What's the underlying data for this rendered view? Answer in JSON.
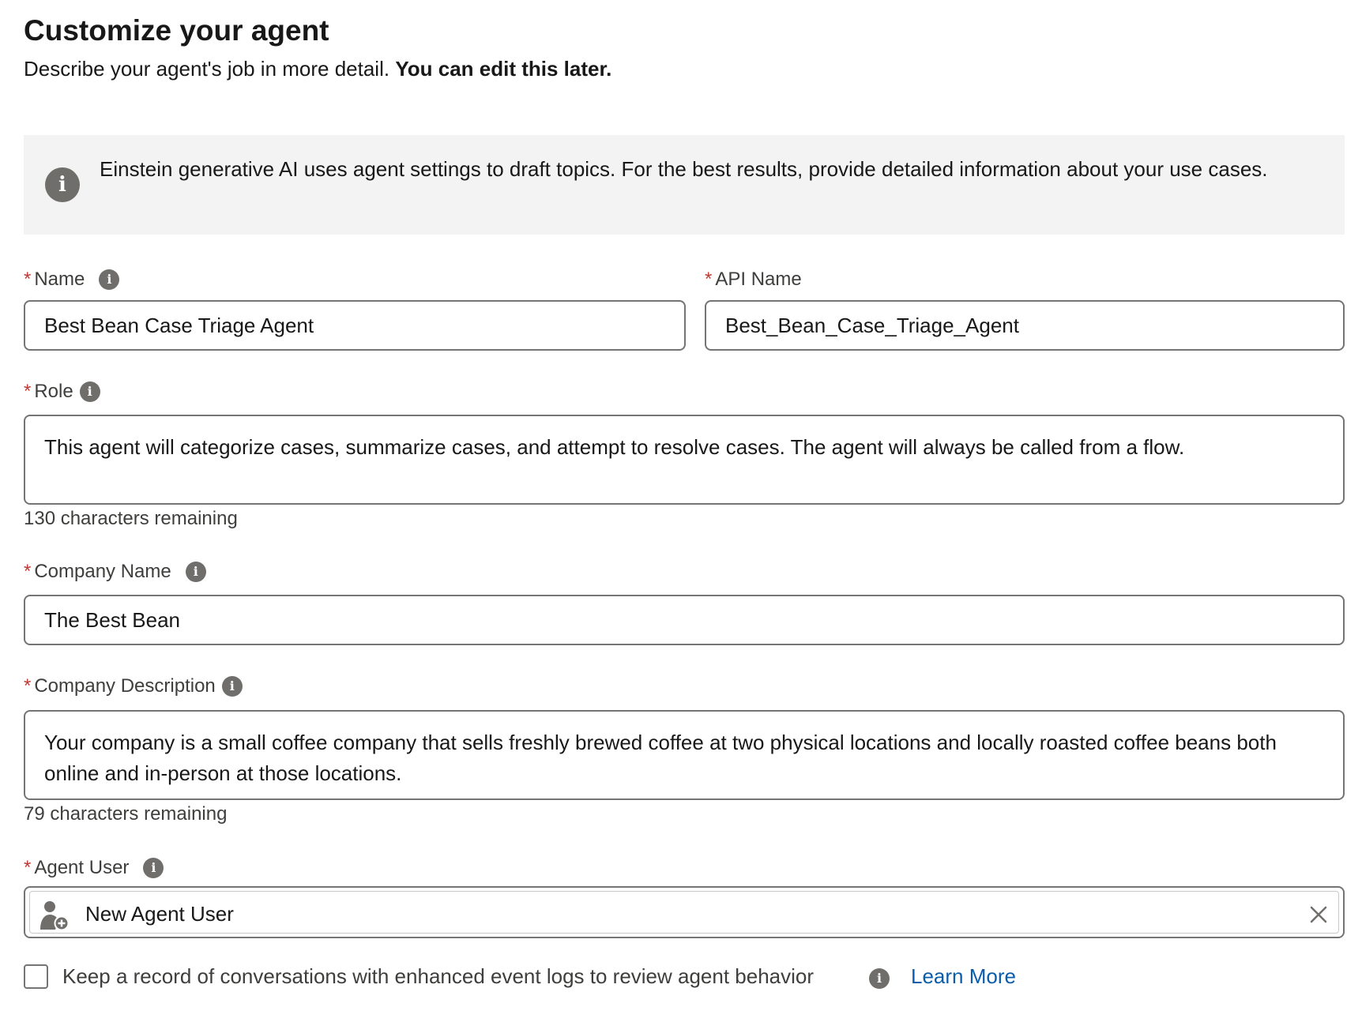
{
  "header": {
    "title": "Customize your agent",
    "subtitle_main": "Describe your agent's job in more detail.",
    "subtitle_bold": "You can edit this later."
  },
  "banner": {
    "icon": "info-icon",
    "text": "Einstein generative AI uses agent settings to draft topics. For the best results, provide detailed information about your use cases."
  },
  "form": {
    "required_marker": "*",
    "name": {
      "label": "Name",
      "value": "Best Bean Case Triage Agent"
    },
    "api_name": {
      "label": "API Name",
      "value": "Best_Bean_Case_Triage_Agent"
    },
    "role": {
      "label": "Role",
      "value": "This agent will categorize cases, summarize cases, and attempt to resolve cases. The agent will always be called from a flow.",
      "remaining": "130 characters remaining"
    },
    "company_name": {
      "label": "Company Name",
      "value": "The Best Bean"
    },
    "company_description": {
      "label": "Company Description",
      "value": "Your company is a small coffee company that sells freshly brewed coffee at two physical locations and locally roasted coffee beans both online and in-person at those locations.",
      "remaining": "79 characters remaining"
    },
    "agent_user": {
      "label": "Agent User",
      "value": "New Agent User",
      "icon": "new-user-icon"
    },
    "event_logs": {
      "label": "Keep a record of conversations with enhanced event logs to review agent behavior",
      "checked": false,
      "link": "Learn More"
    }
  },
  "colors": {
    "required": "#c23934",
    "link": "#0b5cab",
    "icon": "#706e6b",
    "banner_bg": "#f3f3f3",
    "border": "#747474"
  }
}
